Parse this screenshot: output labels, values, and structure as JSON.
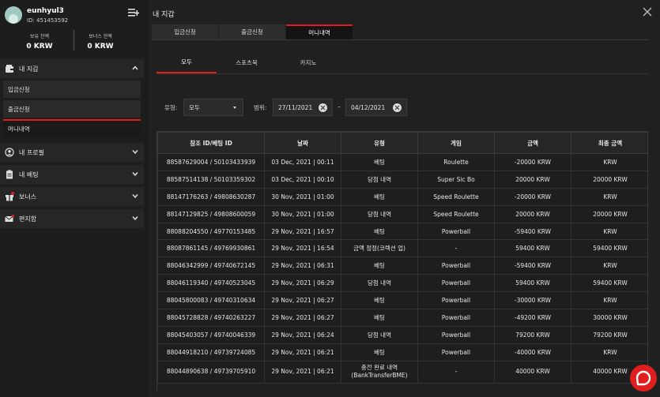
{
  "user": {
    "name": "eunhyul3",
    "id": "ID: 451453592",
    "balance_label": "보유 잔액",
    "balance_value": "0 KRW",
    "bonus_label": "보너스 잔액",
    "bonus_value": "0 KRW"
  },
  "sidebar": {
    "wallet": "내 지갑",
    "wallet_items": [
      "입금신청",
      "출금신청",
      "머니내역"
    ],
    "profile": "내 프로필",
    "bets": "내 베팅",
    "bonus": "보너스",
    "mailbox": "편지함"
  },
  "panel": {
    "title": "내 지갑",
    "tabs": [
      "입금신청",
      "출금신청",
      "머니내역"
    ],
    "subtabs": [
      "모두",
      "스포츠북",
      "카지노"
    ]
  },
  "filter": {
    "type_label": "유형:",
    "type_value": "모두",
    "range_label": "범위:",
    "date_from": "27/11/2021",
    "dash": "–",
    "date_to": "04/12/2021"
  },
  "table": {
    "headers": [
      "참조 ID/베팅 ID",
      "날짜",
      "유형",
      "게임",
      "금액",
      "최종 금액"
    ],
    "rows": [
      [
        "88587629004 / 50103433939",
        "03 Dec, 2021 | 00:11",
        "베팅",
        "Roulette",
        "-20000 KRW",
        "KRW"
      ],
      [
        "88587514138 / 50103359302",
        "03 Dec, 2021 | 00:10",
        "당첨 내역",
        "Super Sic Bo",
        "20000 KRW",
        "20000 KRW"
      ],
      [
        "88147176263 / 49808630287",
        "30 Nov, 2021 | 01:00",
        "베팅",
        "Speed Roulette",
        "-20000 KRW",
        "KRW"
      ],
      [
        "88147129825 / 49808600059",
        "30 Nov, 2021 | 01:00",
        "당첨 내역",
        "Speed Roulette",
        "20000 KRW",
        "20000 KRW"
      ],
      [
        "88088204550 / 49770153485",
        "29 Nov, 2021 | 16:57",
        "베팅",
        "Powerball",
        "-59400 KRW",
        "KRW"
      ],
      [
        "88087861145 / 49769930861",
        "29 Nov, 2021 | 16:54",
        "금액 정정(코렉션 업)",
        "-",
        "59400 KRW",
        "59400 KRW"
      ],
      [
        "88046342999 / 49740672145",
        "29 Nov, 2021 | 06:31",
        "베팅",
        "Powerball",
        "-59400 KRW",
        "KRW"
      ],
      [
        "88046119340 / 49740523045",
        "29 Nov, 2021 | 06:29",
        "당첨 내역",
        "Powerball",
        "59400 KRW",
        "59400 KRW"
      ],
      [
        "88045800083 / 49740310634",
        "29 Nov, 2021 | 06:27",
        "베팅",
        "Powerball",
        "-30000 KRW",
        "KRW"
      ],
      [
        "88045728828 / 49740263227",
        "29 Nov, 2021 | 06:27",
        "베팅",
        "Powerball",
        "-49200 KRW",
        "30000 KRW"
      ],
      [
        "88045403057 / 49740046339",
        "29 Nov, 2021 | 06:24",
        "당첨 내역",
        "Powerball",
        "79200 KRW",
        "79200 KRW"
      ],
      [
        "88044918210 / 49739724085",
        "29 Nov, 2021 | 06:21",
        "베팅",
        "Powerball",
        "-40000 KRW",
        "KRW"
      ],
      [
        "88044890638 / 49739705910",
        "29 Nov, 2021 | 06:21",
        "충전 완료 내역 (BankTransferBME)",
        "-",
        "40000 KRW",
        "40000 KRW"
      ]
    ]
  },
  "colors": {
    "accent": "#e01e1e",
    "bg": "#1b1b1b",
    "panel": "#202020"
  },
  "icons": [
    "menu-icon",
    "wallet-icon",
    "chevron-up-icon",
    "chevron-down-icon",
    "profile-icon",
    "bets-icon",
    "gift-icon",
    "mail-icon",
    "close-icon",
    "chat-icon"
  ]
}
